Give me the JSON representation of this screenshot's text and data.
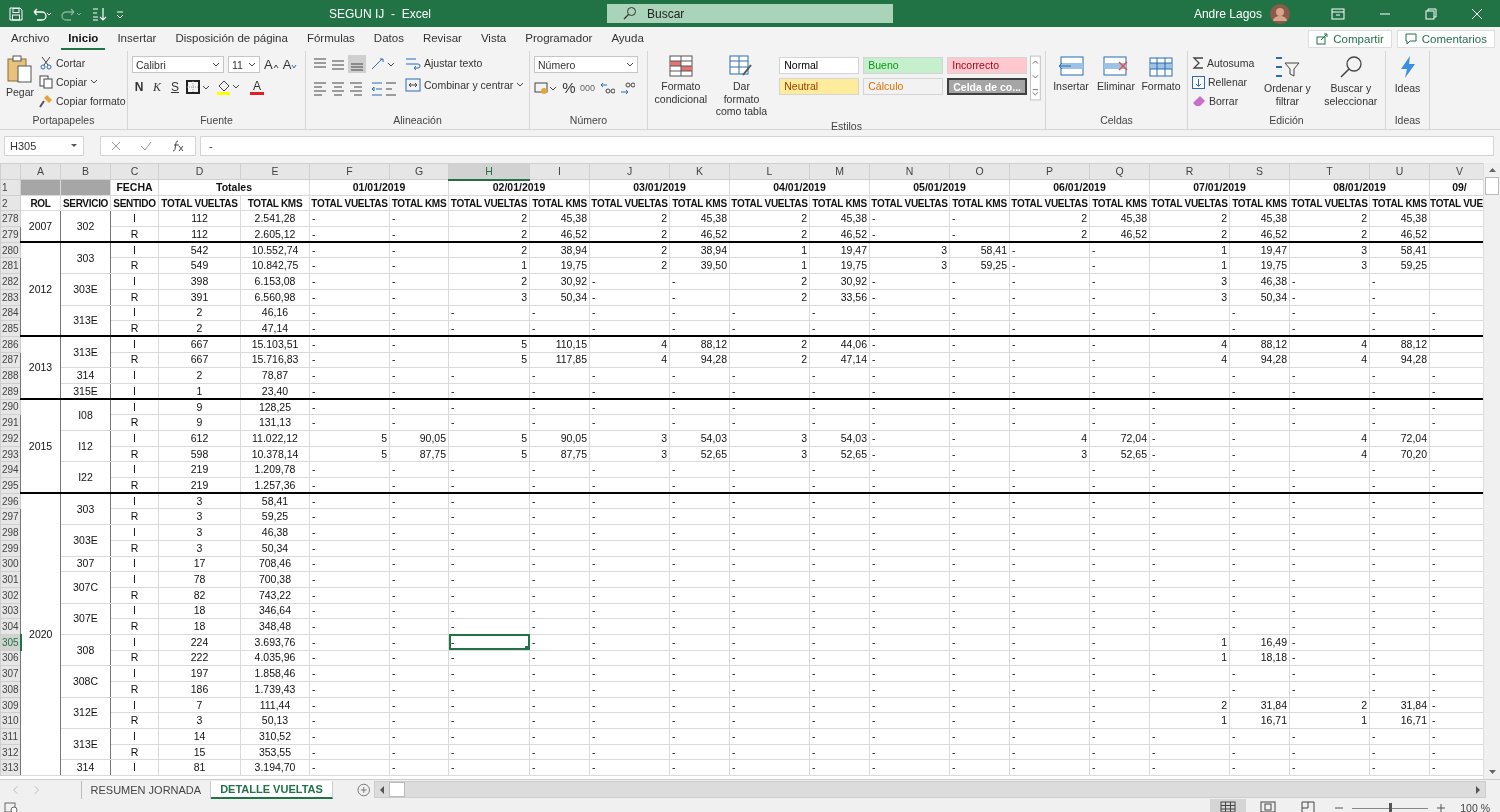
{
  "window": {
    "title": "SEGUN IJ  -  Excel",
    "search_placeholder": "Buscar",
    "user": "Andre Lagos"
  },
  "ribbon_tabs": [
    {
      "label": "Archivo",
      "selected": false
    },
    {
      "label": "Inicio",
      "selected": true
    },
    {
      "label": "Insertar",
      "selected": false
    },
    {
      "label": "Disposición de página",
      "selected": false
    },
    {
      "label": "Fórmulas",
      "selected": false
    },
    {
      "label": "Datos",
      "selected": false
    },
    {
      "label": "Revisar",
      "selected": false
    },
    {
      "label": "Vista",
      "selected": false
    },
    {
      "label": "Programador",
      "selected": false
    },
    {
      "label": "Ayuda",
      "selected": false
    }
  ],
  "ribbon_buttons": [
    "Compartir",
    "Comentarios"
  ],
  "ribbon": {
    "clipboard": {
      "label": "Portapapeles",
      "paste": "Pegar",
      "cut": "Cortar",
      "copy": "Copiar",
      "format_painter": "Copiar formato"
    },
    "font": {
      "label": "Fuente",
      "font_name": "Calibri",
      "font_size": "11",
      "grow": "A",
      "shrink": "A",
      "bold": "N",
      "italic": "K",
      "underline": "S",
      "font_color": "A"
    },
    "alignment": {
      "label": "Alineación",
      "wrap": "Ajustar texto",
      "merge": "Combinar y centrar"
    },
    "number": {
      "label": "Número",
      "format": "Número",
      "percent": "%",
      "thousands": "000"
    },
    "styles": {
      "label": "Estilos",
      "conditional": "Formato condicional",
      "table": "Dar formato como tabla",
      "cell_styles": [
        {
          "label": "Normal",
          "color": "#ffffff"
        },
        {
          "label": "Bueno",
          "color": "#c6efce"
        },
        {
          "label": "Incorrecto",
          "color": "#ffc7ce"
        },
        {
          "label": "Neutral",
          "color": "#ffeb9c"
        },
        {
          "label": "Cálculo",
          "color": "#f2f2f2"
        },
        {
          "label": "Celda de co...",
          "color": "#a5a5a5"
        }
      ]
    },
    "cells": {
      "label": "Celdas",
      "insert": "Insertar",
      "delete": "Eliminar",
      "format": "Formato"
    },
    "editing": {
      "label": "Edición",
      "autosum": "Autosuma",
      "fill": "Rellenar",
      "clear": "Borrar",
      "sort": "Ordenar y filtrar",
      "find": "Buscar y seleccionar"
    },
    "ideas": {
      "label": "Ideas",
      "button": "Ideas"
    }
  },
  "formula_bar": {
    "name_box": "H305",
    "formula": "-"
  },
  "sheet": {
    "columns": [
      {
        "label": "A",
        "selected": false
      },
      {
        "label": "B",
        "selected": false
      },
      {
        "label": "C",
        "selected": false
      },
      {
        "label": "D",
        "selected": false
      },
      {
        "label": "E",
        "selected": false
      },
      {
        "label": "F",
        "selected": false
      },
      {
        "label": "G",
        "selected": false
      },
      {
        "label": "H",
        "selected": true
      },
      {
        "label": "I",
        "selected": false
      },
      {
        "label": "J",
        "selected": false
      },
      {
        "label": "K",
        "selected": false
      },
      {
        "label": "L",
        "selected": false
      },
      {
        "label": "M",
        "selected": false
      },
      {
        "label": "N",
        "selected": false
      },
      {
        "label": "O",
        "selected": false
      },
      {
        "label": "P",
        "selected": false
      },
      {
        "label": "Q",
        "selected": false
      },
      {
        "label": "R",
        "selected": false
      },
      {
        "label": "S",
        "selected": false
      },
      {
        "label": "T",
        "selected": false
      },
      {
        "label": "U",
        "selected": false
      },
      {
        "label": "V",
        "selected": false
      }
    ],
    "row1": {
      "number": "1",
      "fecha": "FECHA",
      "totales": "Totales",
      "dates": [
        "01/01/2019",
        "02/01/2019",
        "03/01/2019",
        "04/01/2019",
        "05/01/2019",
        "06/01/2019",
        "07/01/2019",
        "08/01/2019"
      ],
      "cut_date": "09/"
    },
    "row2": {
      "number": "2",
      "titles": [
        "ROL",
        "SERVICIO",
        "SENTIDO",
        "TOTAL VUELTAS",
        "TOTAL KMS",
        "TOTAL VUELTAS",
        "TOTAL KMS",
        "TOTAL VUELTAS",
        "TOTAL KMS",
        "TOTAL VUELTAS",
        "TOTAL KMS",
        "TOTAL VUELTAS",
        "TOTAL KMS",
        "TOTAL VUELTAS",
        "TOTAL KMS",
        "TOTAL VUELTAS",
        "TOTAL KMS",
        "TOTAL VUELTAS",
        "TOTAL KMS",
        "TOTAL VUELTAS",
        "TOTAL KMS",
        "TOTAL VUE"
      ]
    },
    "groups": [
      {
        "rol": "2007",
        "services": [
          {
            "servicio": "302",
            "rows": [
              {
                "number": "278",
                "selected": false,
                "sentido": "I",
                "total_vueltas": "112",
                "total_kms": "2.541,28",
                "cells": [
                  "-",
                  "-",
                  "2",
                  "45,38",
                  "2",
                  "45,38",
                  "2",
                  "45,38",
                  "-",
                  "-",
                  "2",
                  "45,38",
                  "2",
                  "45,38",
                  "2",
                  "45,38",
                  ""
                ]
              },
              {
                "number": "279",
                "selected": false,
                "sentido": "R",
                "total_vueltas": "112",
                "total_kms": "2.605,12",
                "cells": [
                  "-",
                  "-",
                  "2",
                  "46,52",
                  "2",
                  "46,52",
                  "2",
                  "46,52",
                  "-",
                  "-",
                  "2",
                  "46,52",
                  "2",
                  "46,52",
                  "2",
                  "46,52",
                  ""
                ]
              }
            ]
          }
        ]
      },
      {
        "rol": "2012",
        "services": [
          {
            "servicio": "303",
            "rows": [
              {
                "number": "280",
                "selected": false,
                "sentido": "I",
                "total_vueltas": "542",
                "total_kms": "10.552,74",
                "cells": [
                  "-",
                  "-",
                  "2",
                  "38,94",
                  "2",
                  "38,94",
                  "1",
                  "19,47",
                  "3",
                  "58,41",
                  "-",
                  "-",
                  "1",
                  "19,47",
                  "3",
                  "58,41",
                  ""
                ]
              },
              {
                "number": "281",
                "selected": false,
                "sentido": "R",
                "total_vueltas": "549",
                "total_kms": "10.842,75",
                "cells": [
                  "-",
                  "-",
                  "1",
                  "19,75",
                  "2",
                  "39,50",
                  "1",
                  "19,75",
                  "3",
                  "59,25",
                  "-",
                  "-",
                  "1",
                  "19,75",
                  "3",
                  "59,25",
                  ""
                ]
              }
            ]
          },
          {
            "servicio": "303E",
            "rows": [
              {
                "number": "282",
                "selected": false,
                "sentido": "I",
                "total_vueltas": "398",
                "total_kms": "6.153,08",
                "cells": [
                  "-",
                  "-",
                  "2",
                  "30,92",
                  "-",
                  "-",
                  "2",
                  "30,92",
                  "-",
                  "-",
                  "-",
                  "-",
                  "3",
                  "46,38",
                  "-",
                  "-",
                  ""
                ]
              },
              {
                "number": "283",
                "selected": false,
                "sentido": "R",
                "total_vueltas": "391",
                "total_kms": "6.560,98",
                "cells": [
                  "-",
                  "-",
                  "3",
                  "50,34",
                  "-",
                  "-",
                  "2",
                  "33,56",
                  "-",
                  "-",
                  "-",
                  "-",
                  "3",
                  "50,34",
                  "-",
                  "-",
                  ""
                ]
              }
            ]
          },
          {
            "servicio": "313E",
            "rows": [
              {
                "number": "284",
                "selected": false,
                "sentido": "I",
                "total_vueltas": "2",
                "total_kms": "46,16",
                "cells": [
                  "-",
                  "-",
                  "-",
                  "-",
                  "-",
                  "-",
                  "-",
                  "-",
                  "-",
                  "-",
                  "-",
                  "-",
                  "-",
                  "-",
                  "-",
                  "-",
                  "-"
                ]
              },
              {
                "number": "285",
                "selected": false,
                "sentido": "R",
                "total_vueltas": "2",
                "total_kms": "47,14",
                "cells": [
                  "-",
                  "-",
                  "-",
                  "-",
                  "-",
                  "-",
                  "-",
                  "-",
                  "-",
                  "-",
                  "-",
                  "-",
                  "-",
                  "-",
                  "-",
                  "-",
                  "-"
                ]
              }
            ]
          }
        ]
      },
      {
        "rol": "2013",
        "services": [
          {
            "servicio": "313E",
            "rows": [
              {
                "number": "286",
                "selected": false,
                "sentido": "I",
                "total_vueltas": "667",
                "total_kms": "15.103,51",
                "cells": [
                  "-",
                  "-",
                  "5",
                  "110,15",
                  "4",
                  "88,12",
                  "2",
                  "44,06",
                  "-",
                  "-",
                  "-",
                  "-",
                  "4",
                  "88,12",
                  "4",
                  "88,12",
                  ""
                ]
              },
              {
                "number": "287",
                "selected": false,
                "sentido": "R",
                "total_vueltas": "667",
                "total_kms": "15.716,83",
                "cells": [
                  "-",
                  "-",
                  "5",
                  "117,85",
                  "4",
                  "94,28",
                  "2",
                  "47,14",
                  "-",
                  "-",
                  "-",
                  "-",
                  "4",
                  "94,28",
                  "4",
                  "94,28",
                  ""
                ]
              }
            ]
          },
          {
            "servicio": "314",
            "rows": [
              {
                "number": "288",
                "selected": false,
                "sentido": "I",
                "total_vueltas": "2",
                "total_kms": "78,87",
                "cells": [
                  "-",
                  "-",
                  "-",
                  "-",
                  "-",
                  "-",
                  "-",
                  "-",
                  "-",
                  "-",
                  "-",
                  "-",
                  "-",
                  "-",
                  "-",
                  "-",
                  "-"
                ]
              }
            ]
          },
          {
            "servicio": "315E",
            "rows": [
              {
                "number": "289",
                "selected": false,
                "sentido": "I",
                "total_vueltas": "1",
                "total_kms": "23,40",
                "cells": [
                  "-",
                  "-",
                  "-",
                  "-",
                  "-",
                  "-",
                  "-",
                  "-",
                  "-",
                  "-",
                  "-",
                  "-",
                  "-",
                  "-",
                  "-",
                  "-",
                  "-"
                ]
              }
            ]
          }
        ]
      },
      {
        "rol": "2015",
        "services": [
          {
            "servicio": "I08",
            "rows": [
              {
                "number": "290",
                "selected": false,
                "sentido": "I",
                "total_vueltas": "9",
                "total_kms": "128,25",
                "cells": [
                  "-",
                  "-",
                  "-",
                  "-",
                  "-",
                  "-",
                  "-",
                  "-",
                  "-",
                  "-",
                  "-",
                  "-",
                  "-",
                  "-",
                  "-",
                  "-",
                  "-"
                ]
              },
              {
                "number": "291",
                "selected": false,
                "sentido": "R",
                "total_vueltas": "9",
                "total_kms": "131,13",
                "cells": [
                  "-",
                  "-",
                  "-",
                  "-",
                  "-",
                  "-",
                  "-",
                  "-",
                  "-",
                  "-",
                  "-",
                  "-",
                  "-",
                  "-",
                  "-",
                  "-",
                  "-"
                ]
              }
            ]
          },
          {
            "servicio": "I12",
            "rows": [
              {
                "number": "292",
                "selected": false,
                "sentido": "I",
                "total_vueltas": "612",
                "total_kms": "11.022,12",
                "cells": [
                  "5",
                  "90,05",
                  "5",
                  "90,05",
                  "3",
                  "54,03",
                  "3",
                  "54,03",
                  "-",
                  "-",
                  "4",
                  "72,04",
                  "-",
                  "-",
                  "4",
                  "72,04",
                  ""
                ]
              },
              {
                "number": "293",
                "selected": false,
                "sentido": "R",
                "total_vueltas": "598",
                "total_kms": "10.378,14",
                "cells": [
                  "5",
                  "87,75",
                  "5",
                  "87,75",
                  "3",
                  "52,65",
                  "3",
                  "52,65",
                  "-",
                  "-",
                  "3",
                  "52,65",
                  "-",
                  "-",
                  "4",
                  "70,20",
                  ""
                ]
              }
            ]
          },
          {
            "servicio": "I22",
            "rows": [
              {
                "number": "294",
                "selected": false,
                "sentido": "I",
                "total_vueltas": "219",
                "total_kms": "1.209,78",
                "cells": [
                  "-",
                  "-",
                  "-",
                  "-",
                  "-",
                  "-",
                  "-",
                  "-",
                  "-",
                  "-",
                  "-",
                  "-",
                  "-",
                  "-",
                  "-",
                  "-",
                  "-"
                ]
              },
              {
                "number": "295",
                "selected": false,
                "sentido": "R",
                "total_vueltas": "219",
                "total_kms": "1.257,36",
                "cells": [
                  "-",
                  "-",
                  "-",
                  "-",
                  "-",
                  "-",
                  "-",
                  "-",
                  "-",
                  "-",
                  "-",
                  "-",
                  "-",
                  "-",
                  "-",
                  "-",
                  "-"
                ]
              }
            ]
          }
        ]
      },
      {
        "rol": "2020",
        "services": [
          {
            "servicio": "303",
            "rows": [
              {
                "number": "296",
                "selected": false,
                "sentido": "I",
                "total_vueltas": "3",
                "total_kms": "58,41",
                "cells": [
                  "-",
                  "-",
                  "-",
                  "-",
                  "-",
                  "-",
                  "-",
                  "-",
                  "-",
                  "-",
                  "-",
                  "-",
                  "-",
                  "-",
                  "-",
                  "-",
                  "-"
                ]
              },
              {
                "number": "297",
                "selected": false,
                "sentido": "R",
                "total_vueltas": "3",
                "total_kms": "59,25",
                "cells": [
                  "-",
                  "-",
                  "-",
                  "-",
                  "-",
                  "-",
                  "-",
                  "-",
                  "-",
                  "-",
                  "-",
                  "-",
                  "-",
                  "-",
                  "-",
                  "-",
                  "-"
                ]
              }
            ]
          },
          {
            "servicio": "303E",
            "rows": [
              {
                "number": "298",
                "selected": false,
                "sentido": "I",
                "total_vueltas": "3",
                "total_kms": "46,38",
                "cells": [
                  "-",
                  "-",
                  "-",
                  "-",
                  "-",
                  "-",
                  "-",
                  "-",
                  "-",
                  "-",
                  "-",
                  "-",
                  "-",
                  "-",
                  "-",
                  "-",
                  "-"
                ]
              },
              {
                "number": "299",
                "selected": false,
                "sentido": "R",
                "total_vueltas": "3",
                "total_kms": "50,34",
                "cells": [
                  "-",
                  "-",
                  "-",
                  "-",
                  "-",
                  "-",
                  "-",
                  "-",
                  "-",
                  "-",
                  "-",
                  "-",
                  "-",
                  "-",
                  "-",
                  "-",
                  "-"
                ]
              }
            ]
          },
          {
            "servicio": "307",
            "rows": [
              {
                "number": "300",
                "selected": false,
                "sentido": "I",
                "total_vueltas": "17",
                "total_kms": "708,46",
                "cells": [
                  "-",
                  "-",
                  "-",
                  "-",
                  "-",
                  "-",
                  "-",
                  "-",
                  "-",
                  "-",
                  "-",
                  "-",
                  "-",
                  "-",
                  "-",
                  "-",
                  "-"
                ]
              }
            ]
          },
          {
            "servicio": "307C",
            "rows": [
              {
                "number": "301",
                "selected": false,
                "sentido": "I",
                "total_vueltas": "78",
                "total_kms": "700,38",
                "cells": [
                  "-",
                  "-",
                  "-",
                  "-",
                  "-",
                  "-",
                  "-",
                  "-",
                  "-",
                  "-",
                  "-",
                  "-",
                  "-",
                  "-",
                  "-",
                  "-",
                  "-"
                ]
              },
              {
                "number": "302",
                "selected": false,
                "sentido": "R",
                "total_vueltas": "82",
                "total_kms": "743,22",
                "cells": [
                  "-",
                  "-",
                  "-",
                  "-",
                  "-",
                  "-",
                  "-",
                  "-",
                  "-",
                  "-",
                  "-",
                  "-",
                  "-",
                  "-",
                  "-",
                  "-",
                  "-"
                ]
              }
            ]
          },
          {
            "servicio": "307E",
            "rows": [
              {
                "number": "303",
                "selected": false,
                "sentido": "I",
                "total_vueltas": "18",
                "total_kms": "346,64",
                "cells": [
                  "-",
                  "-",
                  "-",
                  "-",
                  "-",
                  "-",
                  "-",
                  "-",
                  "-",
                  "-",
                  "-",
                  "-",
                  "-",
                  "-",
                  "-",
                  "-",
                  "-"
                ]
              },
              {
                "number": "304",
                "selected": false,
                "sentido": "R",
                "total_vueltas": "18",
                "total_kms": "348,48",
                "cells": [
                  "-",
                  "-",
                  "-",
                  "-",
                  "-",
                  "-",
                  "-",
                  "-",
                  "-",
                  "-",
                  "-",
                  "-",
                  "-",
                  "-",
                  "-",
                  "-",
                  "-"
                ]
              }
            ]
          },
          {
            "servicio": "308",
            "rows": [
              {
                "number": "305",
                "selected": true,
                "sentido": "I",
                "total_vueltas": "224",
                "total_kms": "3.693,76",
                "cells": [
                  "-",
                  "-",
                  "-",
                  "-",
                  "-",
                  "-",
                  "-",
                  "-",
                  "-",
                  "-",
                  "-",
                  "-",
                  "1",
                  "16,49",
                  "-",
                  "-",
                  ""
                ]
              },
              {
                "number": "306",
                "selected": false,
                "sentido": "R",
                "total_vueltas": "222",
                "total_kms": "4.035,96",
                "cells": [
                  "-",
                  "-",
                  "-",
                  "-",
                  "-",
                  "-",
                  "-",
                  "-",
                  "-",
                  "-",
                  "-",
                  "-",
                  "1",
                  "18,18",
                  "-",
                  "-",
                  ""
                ]
              }
            ]
          },
          {
            "servicio": "308C",
            "rows": [
              {
                "number": "307",
                "selected": false,
                "sentido": "I",
                "total_vueltas": "197",
                "total_kms": "1.858,46",
                "cells": [
                  "-",
                  "-",
                  "-",
                  "-",
                  "-",
                  "-",
                  "-",
                  "-",
                  "-",
                  "-",
                  "-",
                  "-",
                  "-",
                  "-",
                  "-",
                  "-",
                  "-"
                ]
              },
              {
                "number": "308",
                "selected": false,
                "sentido": "R",
                "total_vueltas": "186",
                "total_kms": "1.739,43",
                "cells": [
                  "-",
                  "-",
                  "-",
                  "-",
                  "-",
                  "-",
                  "-",
                  "-",
                  "-",
                  "-",
                  "-",
                  "-",
                  "-",
                  "-",
                  "-",
                  "-",
                  "-"
                ]
              }
            ]
          },
          {
            "servicio": "312E",
            "rows": [
              {
                "number": "309",
                "selected": false,
                "sentido": "I",
                "total_vueltas": "7",
                "total_kms": "111,44",
                "cells": [
                  "-",
                  "-",
                  "-",
                  "-",
                  "-",
                  "-",
                  "-",
                  "-",
                  "-",
                  "-",
                  "-",
                  "-",
                  "2",
                  "31,84",
                  "2",
                  "31,84",
                  "-"
                ]
              },
              {
                "number": "310",
                "selected": false,
                "sentido": "R",
                "total_vueltas": "3",
                "total_kms": "50,13",
                "cells": [
                  "-",
                  "-",
                  "-",
                  "-",
                  "-",
                  "-",
                  "-",
                  "-",
                  "-",
                  "-",
                  "-",
                  "-",
                  "1",
                  "16,71",
                  "1",
                  "16,71",
                  "-"
                ]
              }
            ]
          },
          {
            "servicio": "313E",
            "rows": [
              {
                "number": "311",
                "selected": false,
                "sentido": "I",
                "total_vueltas": "14",
                "total_kms": "310,52",
                "cells": [
                  "-",
                  "-",
                  "-",
                  "-",
                  "-",
                  "-",
                  "-",
                  "-",
                  "-",
                  "-",
                  "-",
                  "-",
                  "-",
                  "-",
                  "-",
                  "-",
                  "-"
                ]
              },
              {
                "number": "312",
                "selected": false,
                "sentido": "R",
                "total_vueltas": "15",
                "total_kms": "353,55",
                "cells": [
                  "-",
                  "-",
                  "-",
                  "-",
                  "-",
                  "-",
                  "-",
                  "-",
                  "-",
                  "-",
                  "-",
                  "-",
                  "-",
                  "-",
                  "-",
                  "-",
                  "-"
                ]
              }
            ]
          },
          {
            "servicio": "314",
            "rows": [
              {
                "number": "313",
                "selected": false,
                "sentido": "I",
                "total_vueltas": "81",
                "total_kms": "3.194,70",
                "cells": [
                  "-",
                  "-",
                  "-",
                  "-",
                  "-",
                  "-",
                  "-",
                  "-",
                  "-",
                  "-",
                  "-",
                  "-",
                  "-",
                  "-",
                  "-",
                  "-",
                  "-"
                ]
              }
            ]
          }
        ]
      }
    ]
  },
  "sheet_tabs": [
    {
      "label": "RESUMEN JORNADA",
      "selected": false
    },
    {
      "label": "DETALLE VUELTAS",
      "selected": true
    }
  ],
  "status_bar": {
    "zoom": "100 %",
    "zoom_slider": {
      "level": 0.5
    }
  }
}
